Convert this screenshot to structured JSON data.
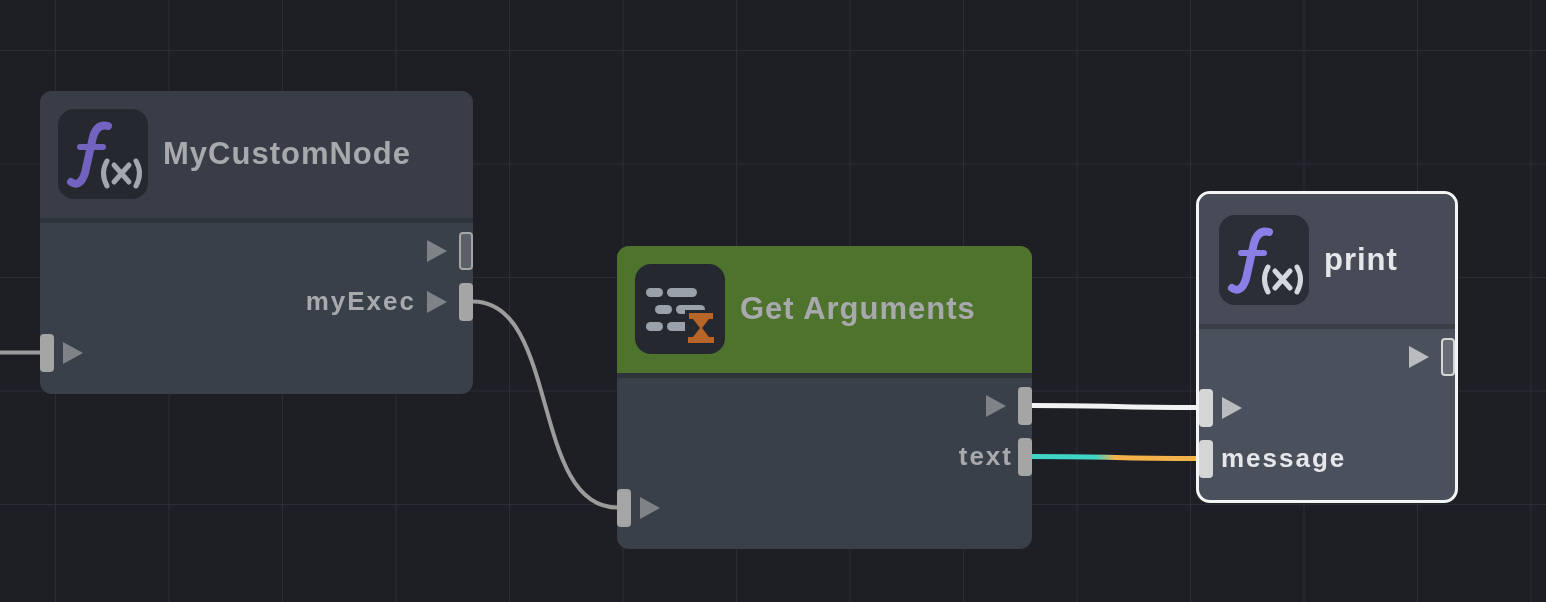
{
  "canvas": {
    "nodes": [
      {
        "kind": "function",
        "title": "MyCustomNode",
        "selected": false,
        "outputs": [
          {
            "kind": "exec",
            "connected": false
          },
          {
            "kind": "exec",
            "label": "myExec",
            "connected": true
          }
        ],
        "inputs": [
          {
            "kind": "exec",
            "connected": true
          }
        ]
      },
      {
        "kind": "getter",
        "title": "Get Arguments",
        "selected": false,
        "outputs": [
          {
            "kind": "exec",
            "connected": true
          },
          {
            "kind": "data",
            "label": "text",
            "connected": true
          }
        ],
        "inputs": [
          {
            "kind": "exec",
            "connected": true
          }
        ]
      },
      {
        "kind": "function",
        "title": "print",
        "selected": true,
        "outputs": [
          {
            "kind": "exec",
            "connected": false
          }
        ],
        "inputs": [
          {
            "kind": "exec",
            "connected": true
          },
          {
            "kind": "data",
            "label": "message",
            "connected": true
          }
        ]
      }
    ],
    "wires": [
      {
        "kind": "exec"
      },
      {
        "kind": "exec"
      },
      {
        "kind": "exec"
      },
      {
        "kind": "data"
      }
    ]
  }
}
